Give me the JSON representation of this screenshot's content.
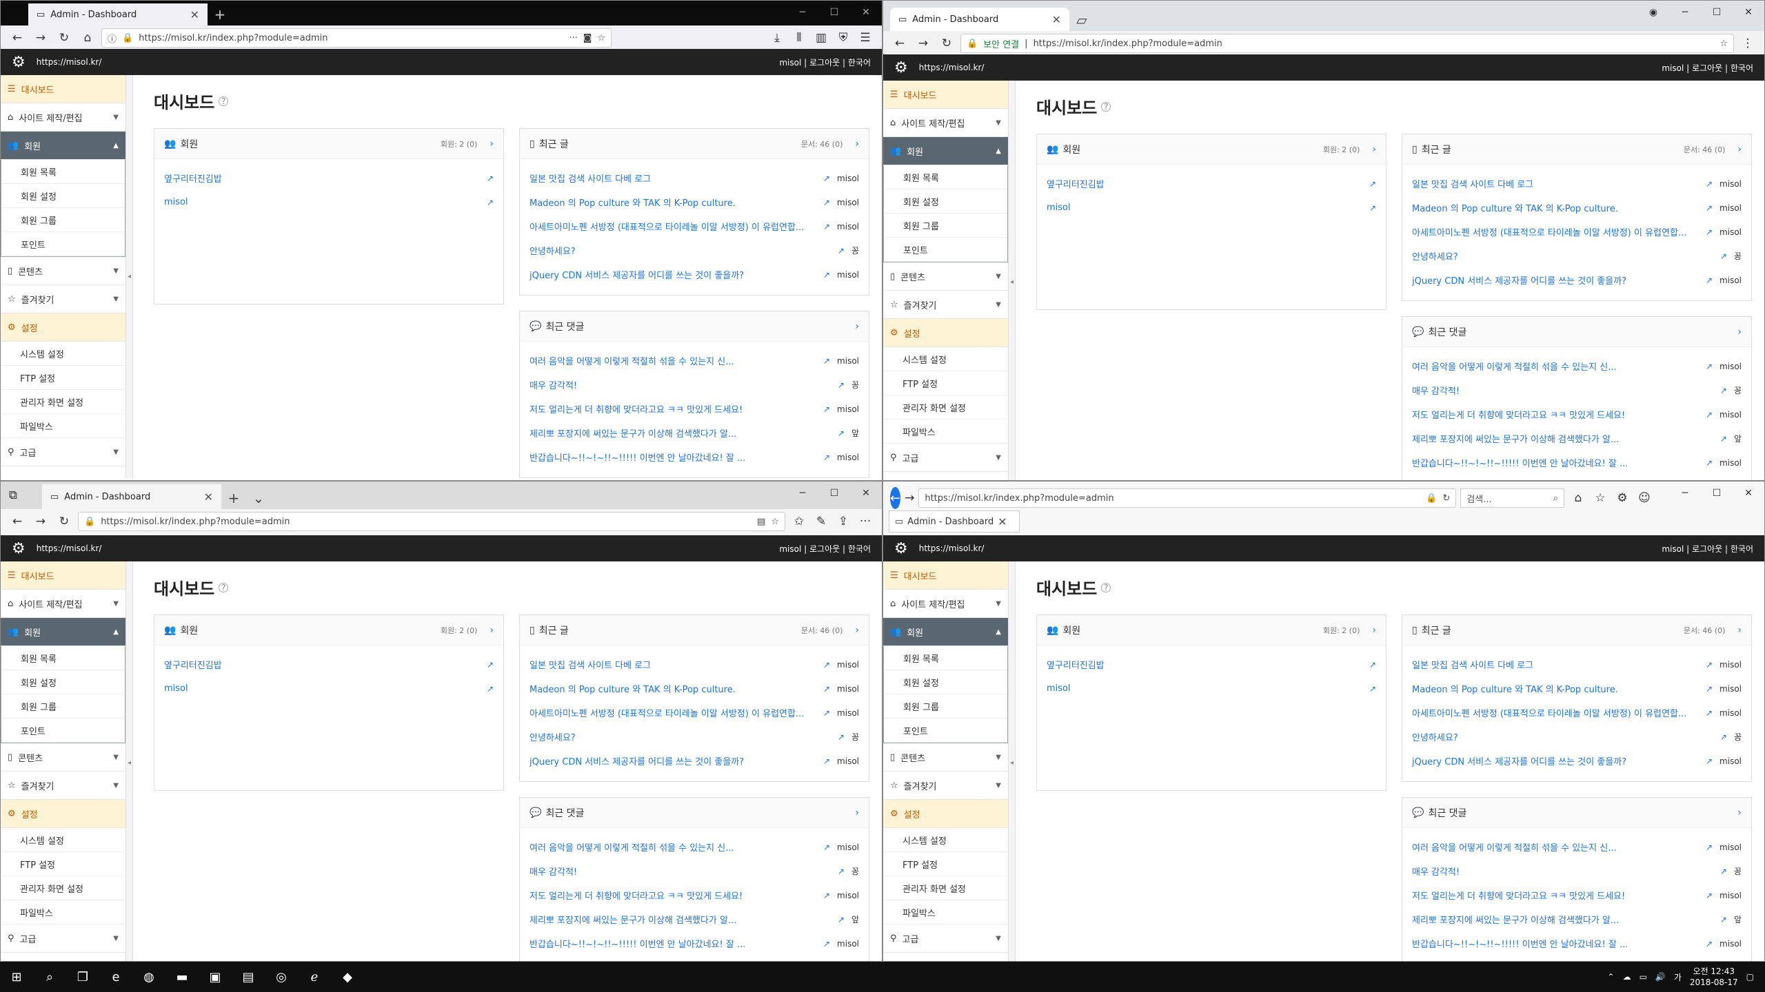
{
  "browser": {
    "tab_title": "Admin - Dashboard",
    "url": "https://misol.kr/index.php?module=admin",
    "url_host": "misol.kr",
    "chrome_secure_label": "보안 연결",
    "ie_search_placeholder": "검색..."
  },
  "app": {
    "site_url": "https://misol.kr/",
    "user": "misol",
    "logout": "로그아웃",
    "language": "한국어",
    "separator": "|",
    "page_title": "대시보드"
  },
  "sidebar": {
    "dashboard": "대시보드",
    "site_build": "사이트 제작/편집",
    "members": "회원",
    "member_sub": [
      "회원 목록",
      "회원 설정",
      "회원 그룹",
      "포인트"
    ],
    "contents": "콘텐츠",
    "favorites": "즐겨찾기",
    "settings": "설정",
    "settings_sub": [
      "시스템 설정",
      "FTP 설정",
      "관리자 화면 설정",
      "파일박스"
    ],
    "advanced": "고급"
  },
  "members_panel": {
    "title": "회원",
    "count": "회원: 2 (0)",
    "items": [
      "옆구리터진김밥",
      "misol"
    ]
  },
  "posts_panel": {
    "title": "최근 글",
    "count": "문서: 46 (0)",
    "items": [
      {
        "title": "일본 맛집 검색 사이트 다베 로그",
        "author": "misol"
      },
      {
        "title": "Madeon 의 Pop culture 와 TAK 의 K-Pop culture.",
        "author": "misol"
      },
      {
        "title": "아세트아미노펜 서방정 (대표적으로 타이레놀 이알 서방정) 이 유럽연합...",
        "author": "misol"
      },
      {
        "title": "안녕하세요?",
        "author": "꽁"
      },
      {
        "title": "jQuery CDN 서비스 제공자를 어디를 쓰는 것이 좋을까?",
        "author": "misol"
      }
    ]
  },
  "comments_panel": {
    "title": "최근 댓글",
    "items": [
      {
        "title": "여러 음악을 어떻게 이렇게 적절히 섞을 수 있는지 신...",
        "author": "misol"
      },
      {
        "title": "매우 감각적!",
        "author": "꽁"
      },
      {
        "title": "저도 얼리는게 더 취향에 맞더라고요 ㅋㅋ 맛있게 드세요!",
        "author": "misol"
      },
      {
        "title": "제리뽀 포장지에 써있는 문구가 이상해 검색했다가 알...",
        "author": "앞"
      },
      {
        "title": "반갑습니다~!!~!~!!~!!!!! 이번엔 안 날아갔네요! 잘 ...",
        "author": "misol"
      }
    ]
  },
  "taskbar": {
    "time": "오전 12:43",
    "date": "2018-08-17"
  },
  "icons": {
    "gear": "gear-icon",
    "external": "external-link-icon",
    "help": "help-icon",
    "user": "user-icon",
    "document": "document-icon",
    "comment": "comment-icon",
    "chevron_right": "chevron-right-icon"
  },
  "colors": {
    "link": "#1a73e8",
    "appbar": "#222222",
    "highlight": "#fff3d6",
    "active_menu": "#5b6770"
  }
}
